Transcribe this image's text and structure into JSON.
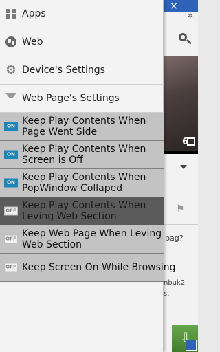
{
  "background_app": {
    "close_glyph": "×",
    "pin_glyph": "✲",
    "video_time_digit": "6",
    "question_fragment": "pag?",
    "text_line_1": "nbuk2",
    "text_line_2": "s.",
    "icons": [
      "close-icon",
      "pin-icon",
      "search-icon",
      "fullscreen-icon",
      "chevron-down-icon",
      "flag-icon",
      "download-icon",
      "resize-icon"
    ]
  },
  "drawer": {
    "menu": [
      {
        "label": "Apps",
        "icon": "grid-icon"
      },
      {
        "label": "Web",
        "icon": "globe-icon"
      },
      {
        "label": "Device's Settings",
        "icon": "gear-icon"
      },
      {
        "label": "Web Page's Settings",
        "icon": "triangle-down-icon"
      }
    ],
    "settings": [
      {
        "toggle": "ON",
        "label": "Keep Play Contents When Page Went Side"
      },
      {
        "toggle": "ON",
        "label": "Keep Play Contents When Screen is Off"
      },
      {
        "toggle": "ON",
        "label": "Keep Play Contents When PopWindow Collaped"
      },
      {
        "toggle": "OFF",
        "label": "Keep Play Contents When Leving Web Section"
      },
      {
        "toggle": "OFF",
        "label": "Keep Web Page When Leving Web Section"
      },
      {
        "toggle": "OFF",
        "label": "Keep Screen On While Browsing"
      }
    ]
  },
  "colors": {
    "top_bar": "#2f63b9",
    "toggle_on": "#1d86b8",
    "highlight_row": "#5b5b5b",
    "setting_row": "#c3c3c3",
    "drawer_bg": "#f3f3f3"
  }
}
